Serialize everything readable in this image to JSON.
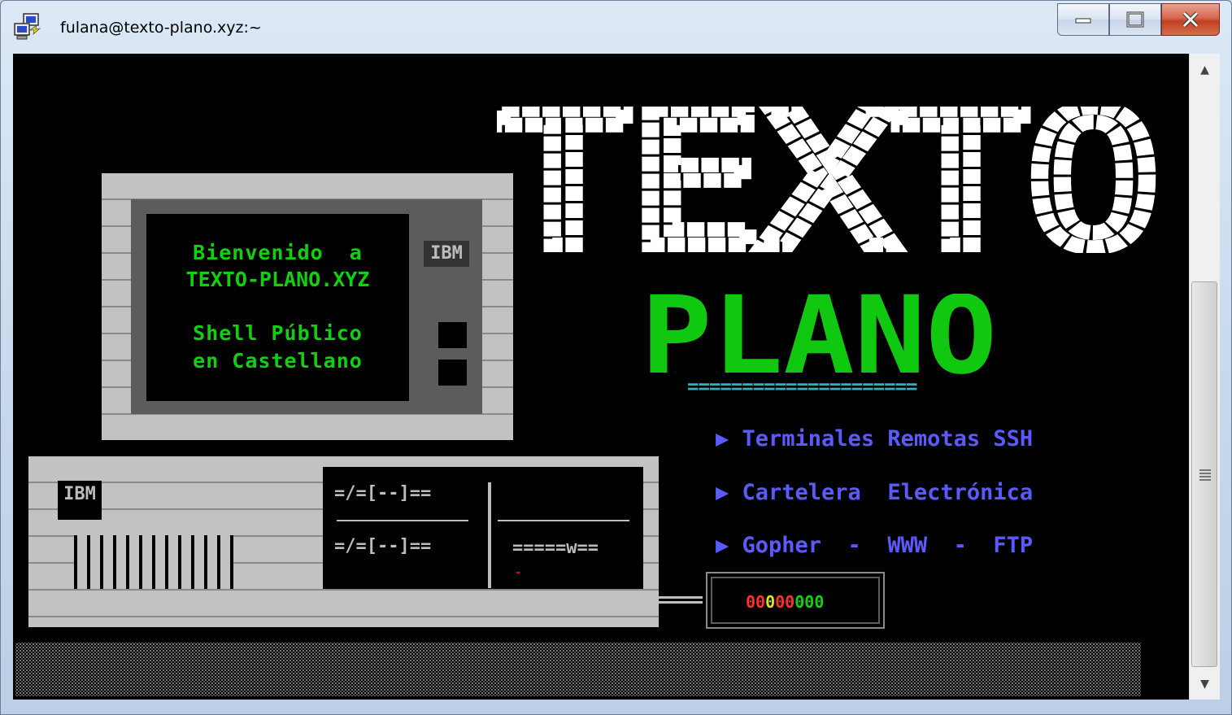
{
  "window": {
    "title": "fulana@texto-plano.xyz:~"
  },
  "terminal": {
    "logo_top": "TEXTO",
    "logo_bottom": "PLANO",
    "underline": "=====================",
    "monitor_brand": "IBM",
    "screen_lines": [
      "Bienvenido  a",
      "TEXTO-PLANO.XYZ",
      "Shell Público",
      "en Castellano"
    ],
    "case_brand": "IBM",
    "drive_a1": "=/=[--]==",
    "drive_a2": "=/=[--]==",
    "drive_b": "=====w==",
    "drive_dot": "-",
    "menu": [
      "Terminales Remotas SSH",
      "Cartelera  Electrónica",
      "Gopher  -  WWW  -  FTP"
    ],
    "modem_leds": "00000000",
    "colors": {
      "background": "#000000",
      "logo_top": "#ffffff",
      "logo_bottom": "#10d010",
      "menu": "#5a5aff",
      "underline": "#30b0c0"
    }
  }
}
